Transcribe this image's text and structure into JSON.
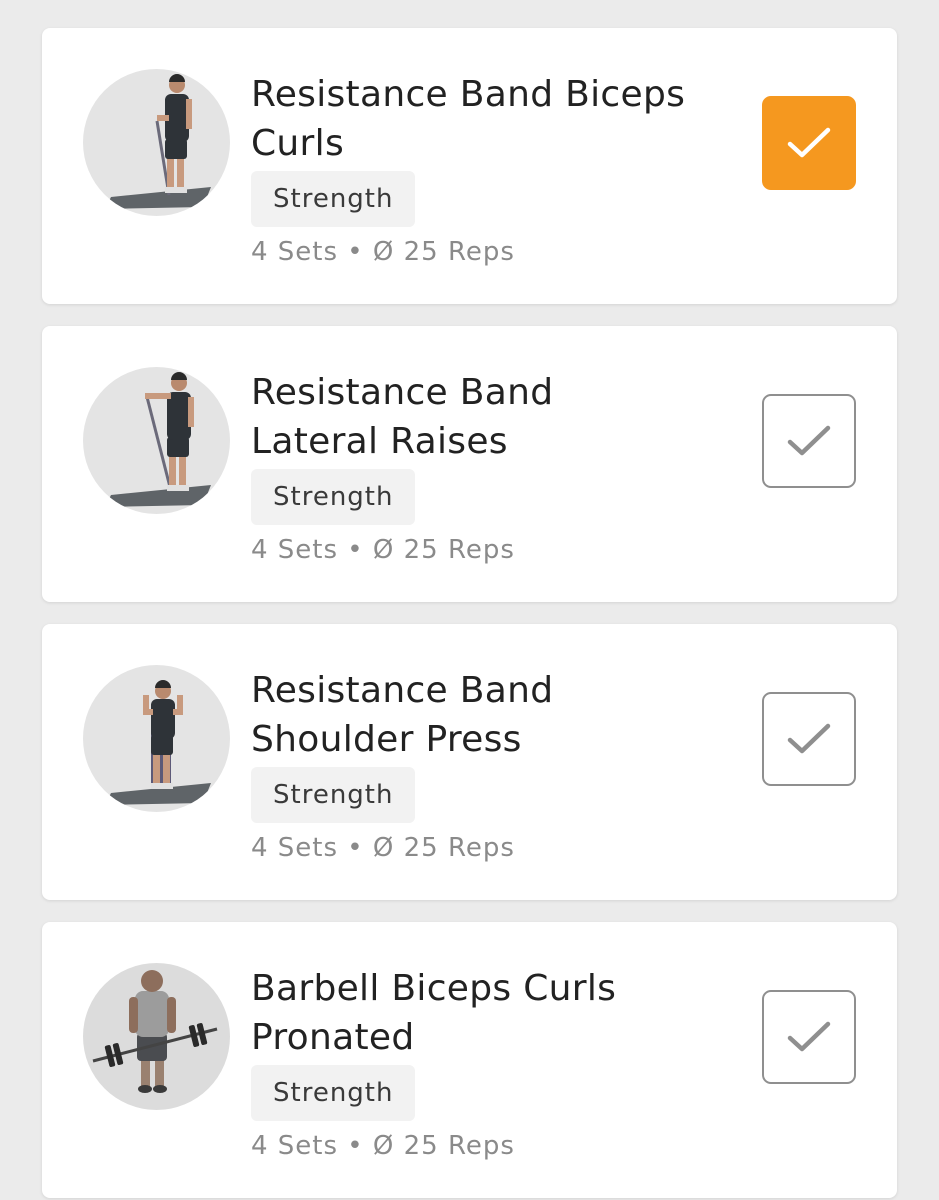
{
  "colors": {
    "accent": "#f5981f",
    "background": "#ebebeb",
    "card": "#ffffff",
    "unchecked_border": "#8f8f8f"
  },
  "exercises": [
    {
      "title_line1": "Resistance Band Biceps",
      "title_line2": "Curls",
      "category": "Strength",
      "meta": "4 Sets • Ø 25 Reps",
      "completed": true,
      "thumbnail_icon": "band-biceps-curl-figure-icon"
    },
    {
      "title_line1": "Resistance Band",
      "title_line2": "Lateral Raises",
      "category": "Strength",
      "meta": "4 Sets • Ø 25 Reps",
      "completed": false,
      "thumbnail_icon": "band-lateral-raise-figure-icon"
    },
    {
      "title_line1": "Resistance Band",
      "title_line2": "Shoulder Press",
      "category": "Strength",
      "meta": "4 Sets • Ø 25 Reps",
      "completed": false,
      "thumbnail_icon": "band-shoulder-press-figure-icon"
    },
    {
      "title_line1": "Barbell Biceps Curls",
      "title_line2": "Pronated",
      "category": "Strength",
      "meta": "4 Sets • Ø 25 Reps",
      "completed": false,
      "thumbnail_icon": "barbell-curl-figure-icon"
    }
  ]
}
